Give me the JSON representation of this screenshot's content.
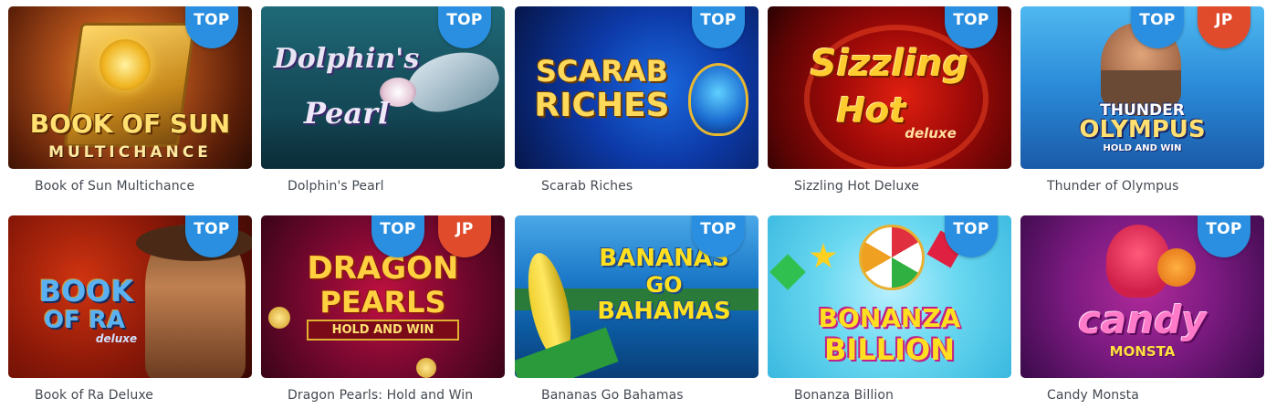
{
  "badges": {
    "top": "TOP",
    "jp": "JP"
  },
  "games": [
    {
      "title": "Book of Sun Multichance",
      "badges": [
        "TOP"
      ],
      "logo_lines": [
        "BOOK OF SUN",
        "MULTICHANCE"
      ]
    },
    {
      "title": "Dolphin's Pearl",
      "badges": [
        "TOP"
      ],
      "logo_lines": [
        "Dolphin's",
        "Pearl"
      ]
    },
    {
      "title": "Scarab Riches",
      "badges": [
        "TOP"
      ],
      "logo_lines": [
        "SCARAB",
        "RICHES"
      ]
    },
    {
      "title": "Sizzling Hot Deluxe",
      "badges": [
        "TOP"
      ],
      "logo_lines": [
        "Sizzling",
        "Hot",
        "deluxe"
      ]
    },
    {
      "title": "Thunder of Olympus",
      "badges": [
        "TOP",
        "JP"
      ],
      "logo_lines": [
        "THUNDER",
        "OLYMPUS",
        "HOLD AND WIN"
      ]
    },
    {
      "title": "Book of Ra Deluxe",
      "badges": [
        "TOP"
      ],
      "logo_lines": [
        "BOOK",
        "OF RA",
        "deluxe"
      ]
    },
    {
      "title": "Dragon Pearls: Hold and Win",
      "badges": [
        "TOP",
        "JP"
      ],
      "logo_lines": [
        "DRAGON",
        "PEARLS",
        "HOLD AND WIN"
      ]
    },
    {
      "title": "Bananas Go Bahamas",
      "badges": [
        "TOP"
      ],
      "logo_lines": [
        "BANANAS",
        "GO",
        "BAHAMAS"
      ]
    },
    {
      "title": "Bonanza Billion",
      "badges": [
        "TOP"
      ],
      "logo_lines": [
        "BONANZA",
        "BILLION"
      ]
    },
    {
      "title": "Candy Monsta",
      "badges": [
        "TOP"
      ],
      "logo_lines": [
        "candy",
        "MONSTA"
      ]
    }
  ],
  "colors": {
    "top_badge": "#2a8fe0",
    "jp_badge": "#e04b2c",
    "title_text": "#444a52"
  }
}
